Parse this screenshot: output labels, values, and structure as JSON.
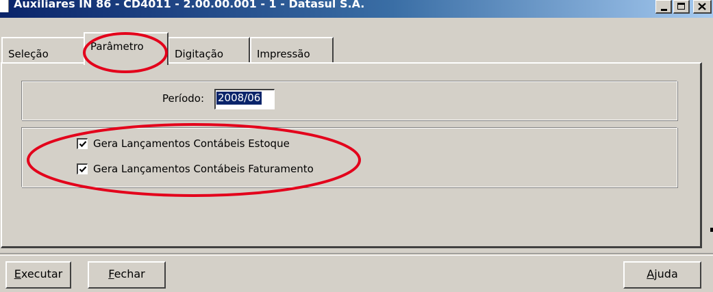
{
  "window": {
    "title": "Auxiliares IN 86 - CD4011 - 2.00.00.001 - 1 - Datasul S.A."
  },
  "tabs": [
    {
      "label": "Seleção"
    },
    {
      "label": "Parâmetro"
    },
    {
      "label": "Digitação"
    },
    {
      "label": "Impressão"
    }
  ],
  "params": {
    "periodo_label": "Período:",
    "periodo_value": "2008/06"
  },
  "options": [
    {
      "label": "Gera Lançamentos Contábeis Estoque",
      "checked": true
    },
    {
      "label": "Gera Lançamentos Contábeis Faturamento",
      "checked": true
    }
  ],
  "buttons": {
    "executar": {
      "first": "E",
      "rest": "xecutar"
    },
    "fechar": {
      "first": "F",
      "rest": "echar"
    },
    "ajuda": {
      "first": "A",
      "rest": "juda"
    }
  },
  "colors": {
    "titlebar_start": "#0a246a",
    "titlebar_end": "#a6caf0",
    "window_face": "#d4d0c8",
    "annotation": "#e3001b"
  }
}
